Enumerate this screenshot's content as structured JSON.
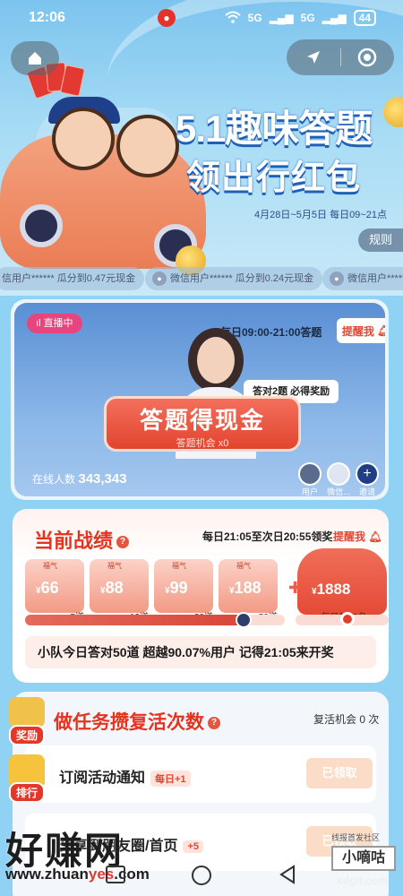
{
  "status_bar": {
    "time": "12:06",
    "network": "5G",
    "network2": "5G",
    "battery": "44"
  },
  "hero": {
    "title": "5.1趣味答题",
    "subtitle": "领出行红包",
    "date_range": "4月28日~5月5日 每日09~21点",
    "rules_label": "规则"
  },
  "ticker": [
    {
      "text": "信用户****** 瓜分到0.47元现金"
    },
    {
      "text": "微信用户****** 瓜分到0.24元现金"
    },
    {
      "text": "微信用户******"
    }
  ],
  "live": {
    "badge": "直播中",
    "daily_time": "每日09:00-21:00答题",
    "remind_label": "提醒我",
    "tip": "答对2题 必得奖励",
    "cash_button": "答题得现金",
    "chances": "答题机会 x0",
    "online_label": "在线人数",
    "online_count": "343,343",
    "avatars": [
      {
        "label": "用户"
      },
      {
        "label": "微信..."
      },
      {
        "label": "邀请"
      }
    ]
  },
  "record": {
    "title": "当前战绩",
    "schedule": "每日21:05至次日20:55领奖",
    "remind_label": "提醒我",
    "tiers": [
      {
        "tag": "福气",
        "currency": "¥",
        "amount": "66",
        "label": "5道"
      },
      {
        "tag": "福气",
        "currency": "¥",
        "amount": "88",
        "label": "10道"
      },
      {
        "tag": "福气",
        "currency": "¥",
        "amount": "99",
        "label": "20道"
      },
      {
        "tag": "福气",
        "currency": "¥",
        "amount": "188",
        "label": "50道"
      }
    ],
    "big_tier": {
      "currency": "¥",
      "amount": "1888",
      "label": "每日前10名"
    },
    "progress_fraction": 0.84,
    "banner": "小队今日答对50道 超越90.07%用户 记得21:05来开奖"
  },
  "tasks": {
    "title": "做任务攒复活次数",
    "revive_label": "复活机会 0 次",
    "items": [
      {
        "name": "订阅活动通知",
        "bonus": "每日+1",
        "button": "已领取"
      },
      {
        "name": "分享到朋友圈/首页",
        "bonus": "+5",
        "button": "已领取"
      }
    ]
  },
  "floating": {
    "reward_label": "奖励",
    "rank_label": "排行"
  },
  "watermark": {
    "big": "好赚网",
    "url_prefix": "www.zhuan",
    "url_highlight": "yes",
    "url_suffix": ".com",
    "right_box": "小嘀咕",
    "right_url": "xdglt.com",
    "right_small": "线报首发社区"
  },
  "colors": {
    "accent": "#e6331f",
    "live_badge": "#e6457d",
    "sky": "#8fd2f4"
  }
}
